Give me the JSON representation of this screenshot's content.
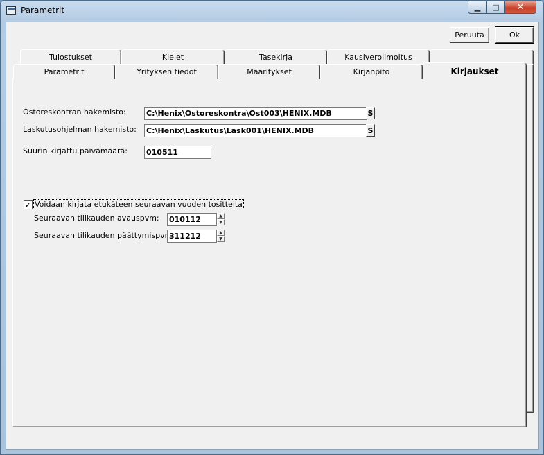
{
  "window": {
    "title": "Parametrit",
    "min_glyph": "▁",
    "max_glyph": "□",
    "close_glyph": "✕"
  },
  "buttons": {
    "cancel": "Peruuta",
    "ok": "Ok"
  },
  "tabs_back_row": [
    "Tulostukset",
    "Kielet",
    "Tasekirja",
    "Kausiveroilmoitus",
    ""
  ],
  "tabs_front_row": [
    "Parametrit",
    "Yrityksen tiedot",
    "Määritykset",
    "Kirjanpito",
    "Kirjaukset"
  ],
  "active_tab": "Kirjaukset",
  "form": {
    "purchase_dir_label": "Ostoreskontran hakemisto:",
    "purchase_dir_value": "C:\\Henix\\Ostoreskontra\\Ost003\\HENIX.MDB",
    "invoice_dir_label": "Laskutusohjelman hakemisto:",
    "invoice_dir_value": "C:\\Henix\\Laskutus\\Lask001\\HENIX.MDB",
    "browse_label": "S",
    "max_date_label": "Suurin kirjattu päivämäärä:",
    "max_date_value": "010511",
    "advance_checkbox_label": "Voidaan kirjata etukäteen seuraavan vuoden tositteita",
    "advance_checked": true,
    "check_glyph": "✓",
    "next_start_label": "Seuraavan tilikauden avauspvm:",
    "next_start_value": "010112",
    "next_end_label": "Seuraavan tilikauden päättymispvm:",
    "next_end_value": "311212",
    "spin_up": "▲",
    "spin_down": "▼"
  }
}
